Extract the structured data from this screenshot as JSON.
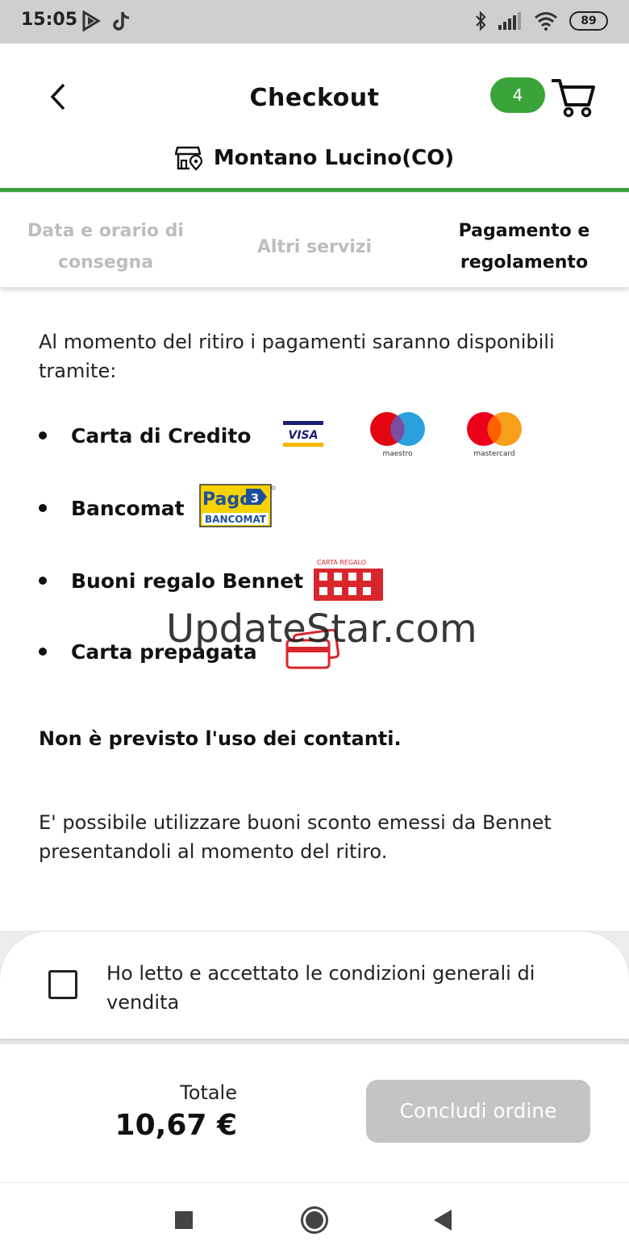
{
  "status_bar": {
    "time": "15:05",
    "battery": "89"
  },
  "header": {
    "title": "Checkout",
    "cart_count": "4",
    "store_name": "Montano Lucino(CO)"
  },
  "steps": [
    {
      "label_line1": "Data e orario di",
      "label_line2": "consegna"
    },
    {
      "label_line1": "Altri servizi",
      "label_line2": ""
    },
    {
      "label_line1": "Pagamento e",
      "label_line2": "regolamento"
    }
  ],
  "content": {
    "intro": "Al momento del ritiro i pagamenti saranno disponibili tramite:",
    "methods": [
      {
        "label": "Carta di Credito"
      },
      {
        "label": "Bancomat"
      },
      {
        "label": "Buoni regalo Bennet"
      },
      {
        "label": "Carta prepagata"
      }
    ],
    "logos": {
      "visa": "VISA",
      "maestro": "maestro",
      "mastercard": "mastercard",
      "pago": "Pago",
      "bancomat": "BANCOMAT",
      "carta_regalo": "CARTA REGALO"
    },
    "no_cash": "Non è previsto l'uso dei contanti.",
    "vouchers": "E' possibile utilizzare buoni sconto emessi da Bennet presentandoli al momento del ritiro."
  },
  "watermark": "UpdateStar.com",
  "terms": {
    "label": "Ho letto e accettato le condizioni generali di vendita",
    "checked": false
  },
  "footer": {
    "total_label": "Totale",
    "total_value": "10,67 €",
    "conclude_label": "Concludi ordine"
  },
  "colors": {
    "accent": "#3aa33a",
    "disabled_button": "#c4c4c4",
    "inactive_step": "#bdbdbd"
  }
}
